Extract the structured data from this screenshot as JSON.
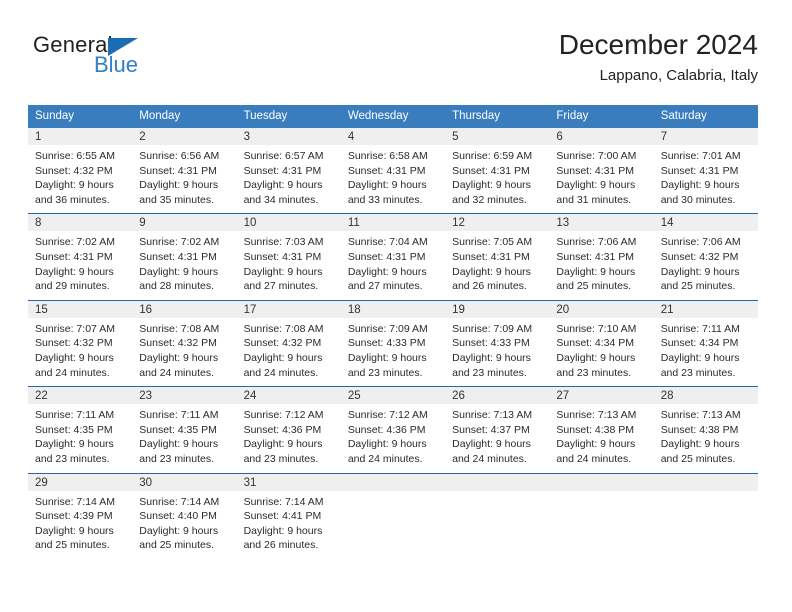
{
  "brand": {
    "word_one": "General",
    "word_two": "Blue",
    "triangle_color": "#1a6cb5",
    "blue_text_color": "#2f80c8"
  },
  "header": {
    "title": "December 2024",
    "subtitle": "Lappano, Calabria, Italy"
  },
  "theme": {
    "header_row_bg": "#3a7dbf",
    "header_row_text": "#ffffff",
    "row_divider": "#2567a8",
    "daynum_band_bg": "#efeff0",
    "body_text": "#2b2b2b"
  },
  "calendar": {
    "weekday_headers": [
      "Sunday",
      "Monday",
      "Tuesday",
      "Wednesday",
      "Thursday",
      "Friday",
      "Saturday"
    ],
    "weeks": [
      [
        {
          "day": "1",
          "lines": [
            "Sunrise: 6:55 AM",
            "Sunset: 4:32 PM",
            "Daylight: 9 hours",
            "and 36 minutes."
          ]
        },
        {
          "day": "2",
          "lines": [
            "Sunrise: 6:56 AM",
            "Sunset: 4:31 PM",
            "Daylight: 9 hours",
            "and 35 minutes."
          ]
        },
        {
          "day": "3",
          "lines": [
            "Sunrise: 6:57 AM",
            "Sunset: 4:31 PM",
            "Daylight: 9 hours",
            "and 34 minutes."
          ]
        },
        {
          "day": "4",
          "lines": [
            "Sunrise: 6:58 AM",
            "Sunset: 4:31 PM",
            "Daylight: 9 hours",
            "and 33 minutes."
          ]
        },
        {
          "day": "5",
          "lines": [
            "Sunrise: 6:59 AM",
            "Sunset: 4:31 PM",
            "Daylight: 9 hours",
            "and 32 minutes."
          ]
        },
        {
          "day": "6",
          "lines": [
            "Sunrise: 7:00 AM",
            "Sunset: 4:31 PM",
            "Daylight: 9 hours",
            "and 31 minutes."
          ]
        },
        {
          "day": "7",
          "lines": [
            "Sunrise: 7:01 AM",
            "Sunset: 4:31 PM",
            "Daylight: 9 hours",
            "and 30 minutes."
          ]
        }
      ],
      [
        {
          "day": "8",
          "lines": [
            "Sunrise: 7:02 AM",
            "Sunset: 4:31 PM",
            "Daylight: 9 hours",
            "and 29 minutes."
          ]
        },
        {
          "day": "9",
          "lines": [
            "Sunrise: 7:02 AM",
            "Sunset: 4:31 PM",
            "Daylight: 9 hours",
            "and 28 minutes."
          ]
        },
        {
          "day": "10",
          "lines": [
            "Sunrise: 7:03 AM",
            "Sunset: 4:31 PM",
            "Daylight: 9 hours",
            "and 27 minutes."
          ]
        },
        {
          "day": "11",
          "lines": [
            "Sunrise: 7:04 AM",
            "Sunset: 4:31 PM",
            "Daylight: 9 hours",
            "and 27 minutes."
          ]
        },
        {
          "day": "12",
          "lines": [
            "Sunrise: 7:05 AM",
            "Sunset: 4:31 PM",
            "Daylight: 9 hours",
            "and 26 minutes."
          ]
        },
        {
          "day": "13",
          "lines": [
            "Sunrise: 7:06 AM",
            "Sunset: 4:31 PM",
            "Daylight: 9 hours",
            "and 25 minutes."
          ]
        },
        {
          "day": "14",
          "lines": [
            "Sunrise: 7:06 AM",
            "Sunset: 4:32 PM",
            "Daylight: 9 hours",
            "and 25 minutes."
          ]
        }
      ],
      [
        {
          "day": "15",
          "lines": [
            "Sunrise: 7:07 AM",
            "Sunset: 4:32 PM",
            "Daylight: 9 hours",
            "and 24 minutes."
          ]
        },
        {
          "day": "16",
          "lines": [
            "Sunrise: 7:08 AM",
            "Sunset: 4:32 PM",
            "Daylight: 9 hours",
            "and 24 minutes."
          ]
        },
        {
          "day": "17",
          "lines": [
            "Sunrise: 7:08 AM",
            "Sunset: 4:32 PM",
            "Daylight: 9 hours",
            "and 24 minutes."
          ]
        },
        {
          "day": "18",
          "lines": [
            "Sunrise: 7:09 AM",
            "Sunset: 4:33 PM",
            "Daylight: 9 hours",
            "and 23 minutes."
          ]
        },
        {
          "day": "19",
          "lines": [
            "Sunrise: 7:09 AM",
            "Sunset: 4:33 PM",
            "Daylight: 9 hours",
            "and 23 minutes."
          ]
        },
        {
          "day": "20",
          "lines": [
            "Sunrise: 7:10 AM",
            "Sunset: 4:34 PM",
            "Daylight: 9 hours",
            "and 23 minutes."
          ]
        },
        {
          "day": "21",
          "lines": [
            "Sunrise: 7:11 AM",
            "Sunset: 4:34 PM",
            "Daylight: 9 hours",
            "and 23 minutes."
          ]
        }
      ],
      [
        {
          "day": "22",
          "lines": [
            "Sunrise: 7:11 AM",
            "Sunset: 4:35 PM",
            "Daylight: 9 hours",
            "and 23 minutes."
          ]
        },
        {
          "day": "23",
          "lines": [
            "Sunrise: 7:11 AM",
            "Sunset: 4:35 PM",
            "Daylight: 9 hours",
            "and 23 minutes."
          ]
        },
        {
          "day": "24",
          "lines": [
            "Sunrise: 7:12 AM",
            "Sunset: 4:36 PM",
            "Daylight: 9 hours",
            "and 23 minutes."
          ]
        },
        {
          "day": "25",
          "lines": [
            "Sunrise: 7:12 AM",
            "Sunset: 4:36 PM",
            "Daylight: 9 hours",
            "and 24 minutes."
          ]
        },
        {
          "day": "26",
          "lines": [
            "Sunrise: 7:13 AM",
            "Sunset: 4:37 PM",
            "Daylight: 9 hours",
            "and 24 minutes."
          ]
        },
        {
          "day": "27",
          "lines": [
            "Sunrise: 7:13 AM",
            "Sunset: 4:38 PM",
            "Daylight: 9 hours",
            "and 24 minutes."
          ]
        },
        {
          "day": "28",
          "lines": [
            "Sunrise: 7:13 AM",
            "Sunset: 4:38 PM",
            "Daylight: 9 hours",
            "and 25 minutes."
          ]
        }
      ],
      [
        {
          "day": "29",
          "lines": [
            "Sunrise: 7:14 AM",
            "Sunset: 4:39 PM",
            "Daylight: 9 hours",
            "and 25 minutes."
          ]
        },
        {
          "day": "30",
          "lines": [
            "Sunrise: 7:14 AM",
            "Sunset: 4:40 PM",
            "Daylight: 9 hours",
            "and 25 minutes."
          ]
        },
        {
          "day": "31",
          "lines": [
            "Sunrise: 7:14 AM",
            "Sunset: 4:41 PM",
            "Daylight: 9 hours",
            "and 26 minutes."
          ]
        },
        {
          "day": "",
          "lines": []
        },
        {
          "day": "",
          "lines": []
        },
        {
          "day": "",
          "lines": []
        },
        {
          "day": "",
          "lines": []
        }
      ]
    ]
  }
}
